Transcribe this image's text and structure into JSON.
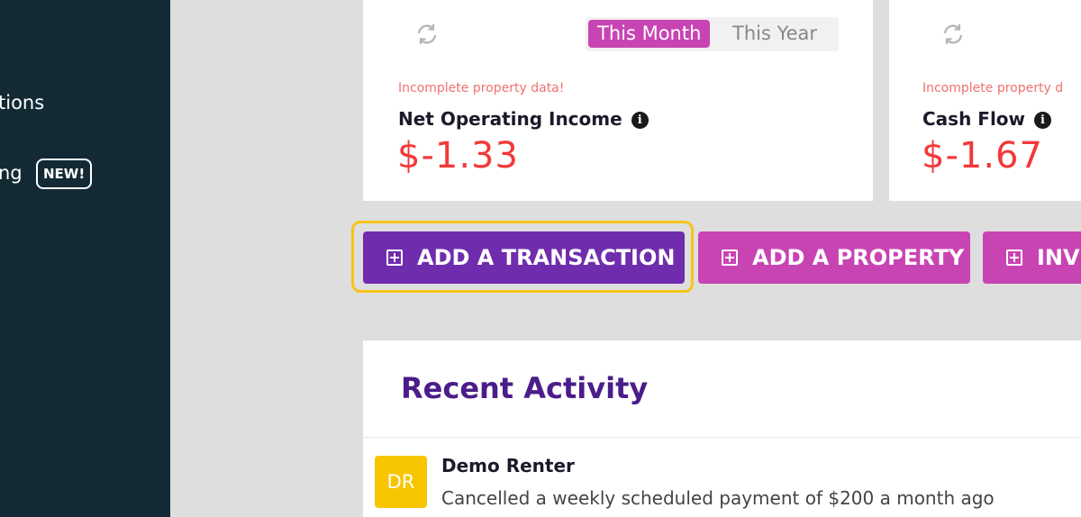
{
  "sidebar": {
    "items": [
      {
        "label": "tions"
      },
      {
        "label": "ng",
        "badge": "NEW!"
      }
    ]
  },
  "cards": {
    "noi": {
      "toggle": {
        "active": "This Month",
        "inactive": "This Year"
      },
      "warning": "Incomplete property data!",
      "label": "Net Operating Income",
      "value": "$-1.33"
    },
    "cashflow": {
      "warning": "Incomplete property d",
      "label": "Cash Flow",
      "value": "$-1.67"
    }
  },
  "actions": {
    "add_transaction": "ADD A TRANSACTION",
    "add_property": "ADD A PROPERTY",
    "invite": "INVI"
  },
  "activity": {
    "title": "Recent Activity",
    "items": [
      {
        "initials": "DR",
        "name": "Demo Renter",
        "description": "Cancelled a weekly scheduled payment of $200 a month ago"
      }
    ]
  },
  "colors": {
    "sidebar": "#132a35",
    "accent_purple": "#6f2dad",
    "accent_magenta": "#c944b3",
    "negative": "#f23838",
    "focus": "#f5c518",
    "avatar": "#f7c600"
  }
}
